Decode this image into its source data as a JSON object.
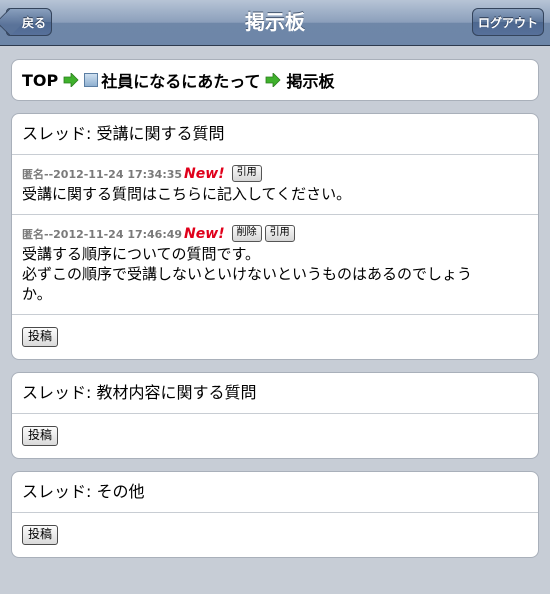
{
  "header": {
    "title": "掲示板",
    "back_label": "戻る",
    "logout_label": "ログアウト"
  },
  "breadcrumb": {
    "top": "TOP",
    "section": "社員になるにあたって",
    "current": "掲示板"
  },
  "threads": [
    {
      "title": "スレッド: 受講に関する質問",
      "posts": [
        {
          "meta": "匿名--2012-11-24 17:34:35",
          "badge": "New!",
          "buttons": [
            "引用"
          ],
          "body": [
            "受講に関する質問はこちらに記入してください。"
          ]
        },
        {
          "meta": "匿名--2012-11-24 17:46:49",
          "badge": "New!",
          "buttons": [
            "削除",
            "引用"
          ],
          "body": [
            "受講する順序についての質問です。",
            "必ずこの順序で受講しないといけないというものはあるのでしょう",
            "か。"
          ]
        }
      ],
      "post_label": "投稿"
    },
    {
      "title": "スレッド: 教材内容に関する質問",
      "posts": [],
      "post_label": "投稿"
    },
    {
      "title": "スレッド: その他",
      "posts": [],
      "post_label": "投稿"
    }
  ],
  "icons": {
    "arrow": "green-arrow-icon",
    "page": "page-icon"
  },
  "colors": {
    "badge": "#e0001b",
    "arrow": "#3fb12c"
  }
}
